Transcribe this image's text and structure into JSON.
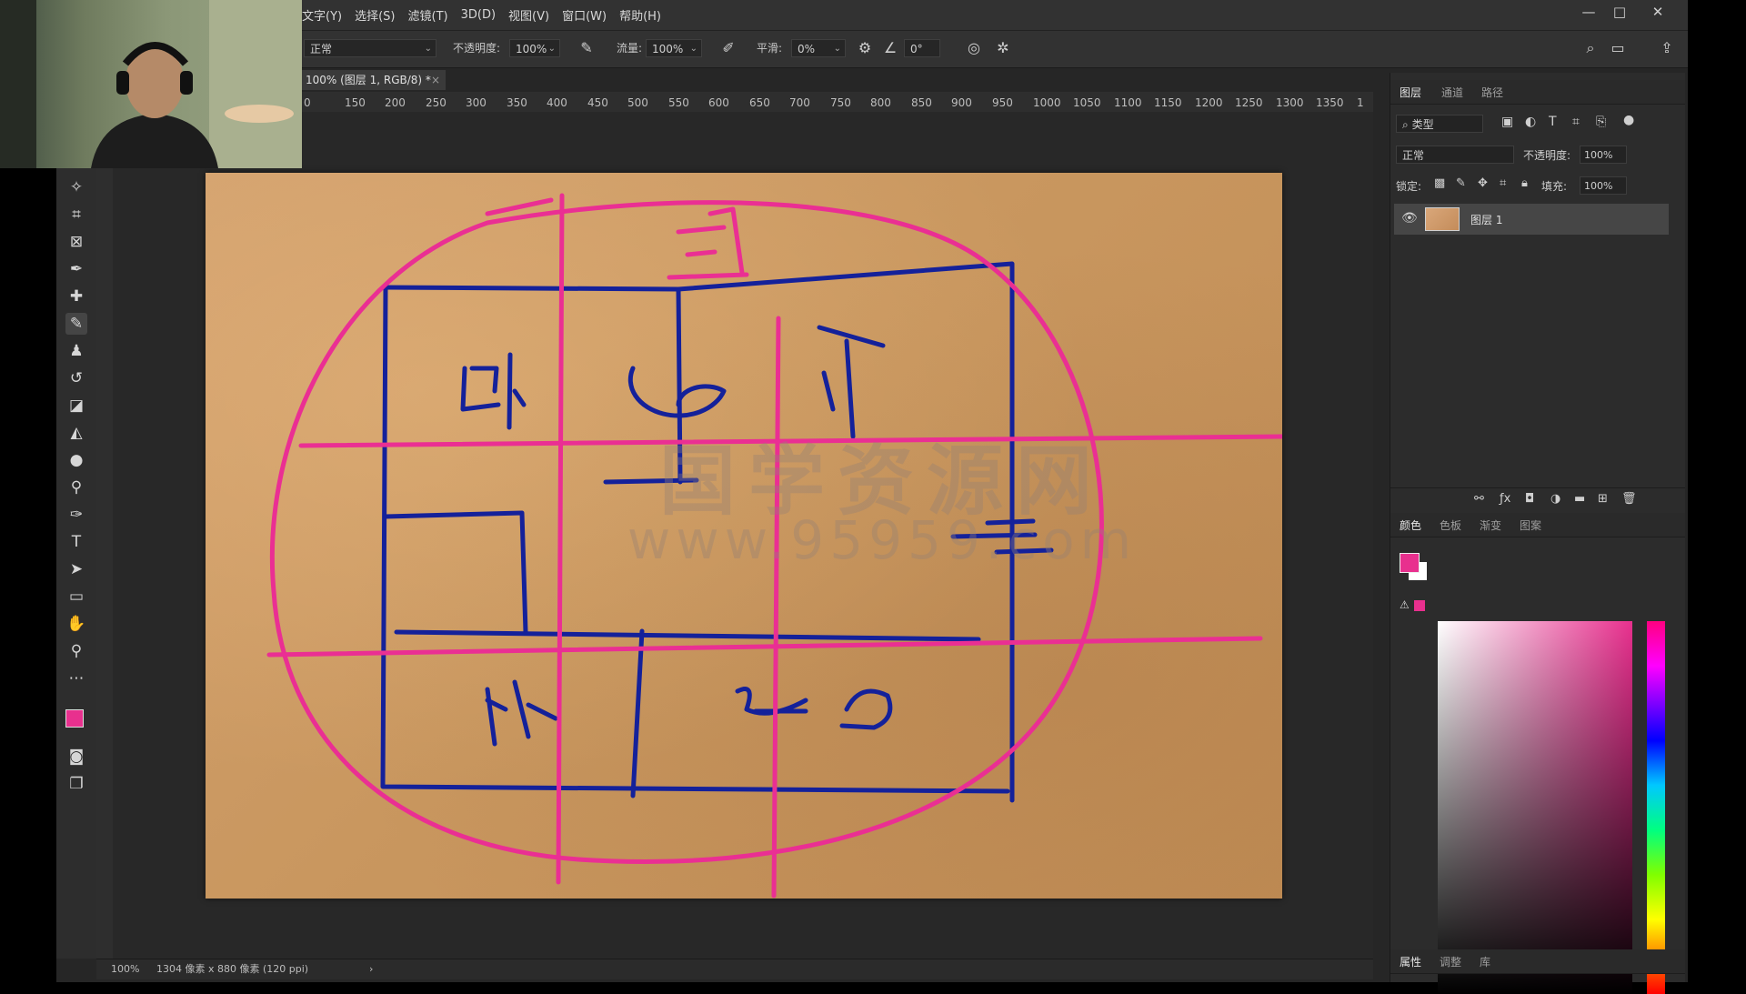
{
  "menu": {
    "items": [
      "文字(Y)",
      "选择(S)",
      "滤镜(T)",
      "3D(D)",
      "视图(V)",
      "窗口(W)",
      "帮助(H)"
    ]
  },
  "window_controls": {
    "minimize": "—",
    "maximize": "□",
    "close": "✕"
  },
  "options": {
    "mode_value": "正常",
    "opacity_label": "不透明度:",
    "opacity_value": "100%",
    "flow_label": "流量:",
    "flow_value": "100%",
    "smoothing_label": "平滑:",
    "smoothing_value": "0%",
    "angle_value": "0°"
  },
  "document_tab": {
    "title": "100% (图层 1, RGB/8) *",
    "close": "×"
  },
  "ruler": {
    "marks": [
      "0",
      "150",
      "200",
      "250",
      "300",
      "350",
      "400",
      "450",
      "500",
      "550",
      "600",
      "650",
      "700",
      "750",
      "800",
      "850",
      "900",
      "950",
      "1000",
      "1050",
      "1100",
      "1150",
      "1200",
      "1250",
      "1300",
      "1350",
      "1"
    ]
  },
  "canvas": {
    "watermark_line1": "国学资源网",
    "watermark_line2": "www.95959.com"
  },
  "status": {
    "zoom": "100%",
    "doc_info": "1304 像素 x 880 像素 (120 ppi)",
    "arrow": "›"
  },
  "layers_panel": {
    "tabs": [
      "图层",
      "通道",
      "路径"
    ],
    "filter_label": "类型",
    "blend_mode": "正常",
    "opacity_label": "不透明度:",
    "opacity_value": "100%",
    "lock_label": "锁定:",
    "fill_label": "填充:",
    "fill_value": "100%",
    "layer_name": "图层 1"
  },
  "color_panel": {
    "tabs": [
      "颜色",
      "色板",
      "渐变",
      "图案"
    ],
    "foreground": "#e8308e",
    "background": "#ffffff"
  },
  "properties_panel": {
    "tabs": [
      "属性",
      "调整",
      "库"
    ]
  },
  "colors": {
    "pink_stroke": "#ea2f93",
    "blue_stroke": "#14219a"
  }
}
